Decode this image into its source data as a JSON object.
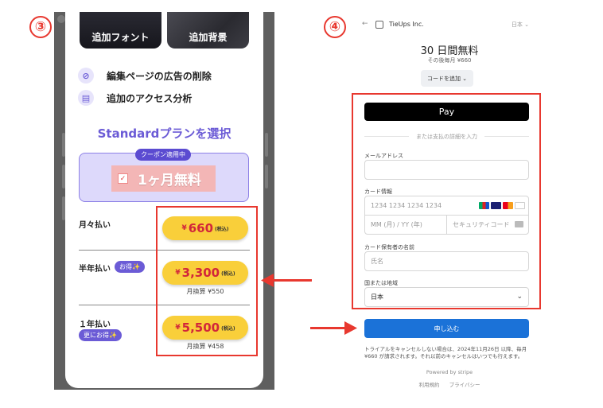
{
  "step_left": "③",
  "step_right": "④",
  "app": {
    "tiles": [
      "追加フォント",
      "追加背景"
    ],
    "features": [
      {
        "icon": "ad-block-icon",
        "label": "編集ページの広告の削除"
      },
      {
        "icon": "analytics-icon",
        "label": "追加のアクセス分析"
      }
    ],
    "plan_title": "Standardプランを選択",
    "coupon_tag": "クーポン適用中",
    "coupon_free": "1ヶ月無料",
    "plans": [
      {
        "label": "月々払い",
        "badge": "",
        "yen": "¥",
        "price": "660",
        "tax": "(税込)",
        "monthly": ""
      },
      {
        "label": "半年払い",
        "badge": "お得✨",
        "yen": "¥",
        "price": "3,300",
        "tax": "(税込)",
        "monthly": "月換算 ¥550"
      },
      {
        "label": "１年払い",
        "badge": "更にお得✨",
        "yen": "¥",
        "price": "5,500",
        "tax": "(税込)",
        "monthly": "月換算 ¥458"
      }
    ]
  },
  "checkout": {
    "back_icon": "←",
    "merchant": "TieUps Inc.",
    "language": "日本 ⌄",
    "trial": "30 日間無料",
    "after": "その後毎月 ¥660",
    "code_button": "コードを追加 ⌄",
    "apple_pay": " Pay",
    "or_text": "または支払の詳細を入力",
    "email_label": "メールアドレス",
    "email_value": "",
    "card_label": "カード情報",
    "card_number_placeholder": "1234 1234 1234 1234",
    "expiry_placeholder": "MM (月) / YY (年)",
    "cvc_placeholder": "セキュリティコード",
    "holder_label": "カード保有者の名前",
    "holder_placeholder": "氏名",
    "country_label": "国または地域",
    "country_value": "日本",
    "submit_label": "申し込む",
    "notice": "トライアルをキャンセルしない場合は、2024年11月26日 以降、毎月¥660 が請求されます。それ以前のキャンセルはいつでも行えます。",
    "powered": "Powered by stripe",
    "links": [
      "利用規約",
      "プライバシー"
    ]
  },
  "colors": {
    "accent": "#6b5bd6",
    "highlight": "#e8382f",
    "price_button": "#f9cf3a",
    "submit": "#1b72d8"
  }
}
